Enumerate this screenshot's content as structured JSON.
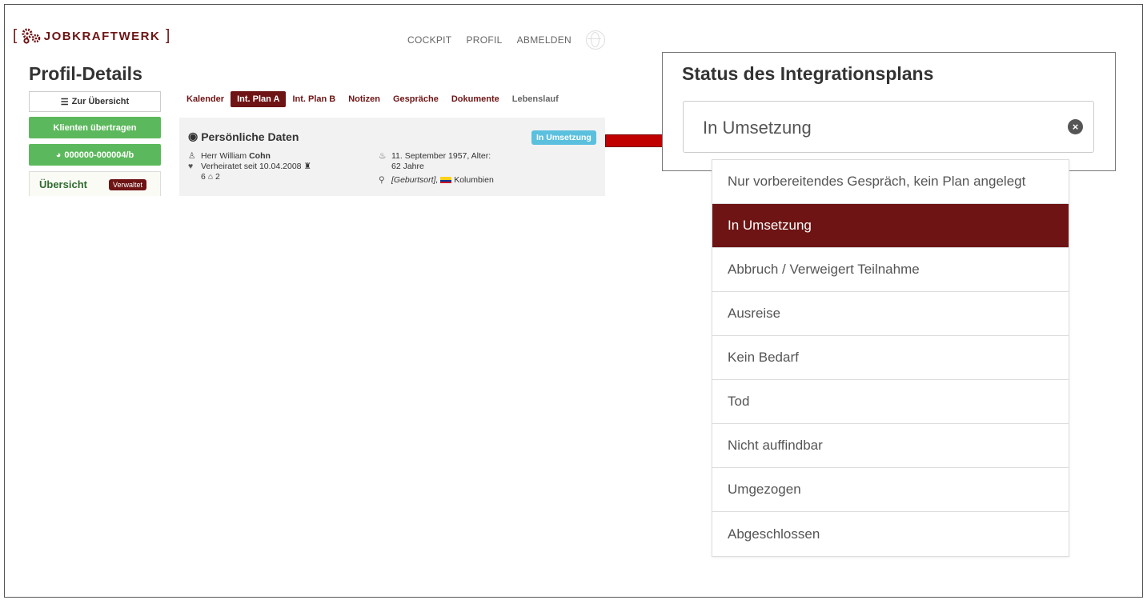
{
  "brand": {
    "logo_text": "JOBKRAFTWERK",
    "accent": "#6e1414"
  },
  "topnav": {
    "items": [
      "COCKPIT",
      "PROFIL",
      "ABMELDEN"
    ]
  },
  "sidebar": {
    "title": "Profil-Details",
    "back_label": "Zur Übersicht",
    "transfer_label": "Klienten übertragen",
    "case_id": "000000-000004/b",
    "overview_label": "Übersicht",
    "overview_badge": "Verwaltet"
  },
  "tabs": [
    {
      "label": "Kalender"
    },
    {
      "label": "Int. Plan A",
      "active": true
    },
    {
      "label": "Int. Plan B"
    },
    {
      "label": "Notizen"
    },
    {
      "label": "Gespräche"
    },
    {
      "label": "Dokumente"
    },
    {
      "label": "Lebenslauf"
    }
  ],
  "personal": {
    "title": "Persönliche Daten",
    "status": "In Umsetzung",
    "salutation": "Herr William",
    "surname": "Cohn",
    "marital": "Verheiratet seit 10.04.2008",
    "counts": "6",
    "household": "2",
    "birth": "11. September 1957, Alter:",
    "age": "62 Jahre",
    "birthplace": "[Geburtsort],",
    "country": "Kolumbien"
  },
  "callout": {
    "title": "Status des Integrationsplans",
    "selected": "In Umsetzung"
  },
  "status_options": [
    "Nur vorbereitendes Gespräch, kein Plan angelegt",
    "In Umsetzung",
    "Abbruch / Verweigert Teilnahme",
    "Ausreise",
    "Kein Bedarf",
    "Tod",
    "Nicht auffindbar",
    "Umgezogen",
    "Abgeschlossen"
  ],
  "selected_index": 1,
  "colors": {
    "primary": "#6e1414",
    "success": "#5cb85c",
    "info": "#5bc0de",
    "arrow": "#c00000"
  }
}
